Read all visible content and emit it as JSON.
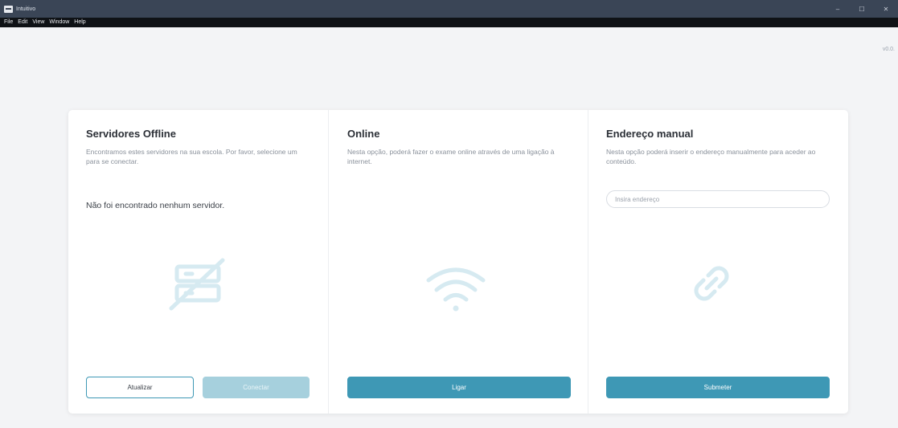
{
  "window": {
    "title": "Intuitivo",
    "minimize": "–",
    "maximize": "☐",
    "close": "✕"
  },
  "menu": [
    "File",
    "Edit",
    "View",
    "Window",
    "Help"
  ],
  "version": "v0.0.",
  "offline": {
    "title": "Servidores Offline",
    "description": "Encontramos estes servidores na sua escola. Por favor, selecione um para se conectar.",
    "empty_message": "Não foi encontrado nenhum servidor.",
    "refresh_label": "Atualizar",
    "connect_label": "Conectar",
    "icon": "servers-off-icon"
  },
  "online": {
    "title": "Online",
    "description": "Nesta opção, poderá fazer o exame online através de uma ligação à internet.",
    "connect_label": "Ligar",
    "icon": "wifi-icon"
  },
  "manual": {
    "title": "Endereço manual",
    "description": "Nesta opção poderá inserir o endereço manualmente para aceder ao conteúdo.",
    "address_placeholder": "Insira endereço",
    "address_value": "",
    "submit_label": "Submeter",
    "icon": "link-icon"
  },
  "colors": {
    "primary": "#3e98b5",
    "primary_disabled": "#a6d0dd",
    "illustration": "#d6eaf1",
    "titlebar": "#3a4556",
    "menubar": "#0f1216"
  }
}
